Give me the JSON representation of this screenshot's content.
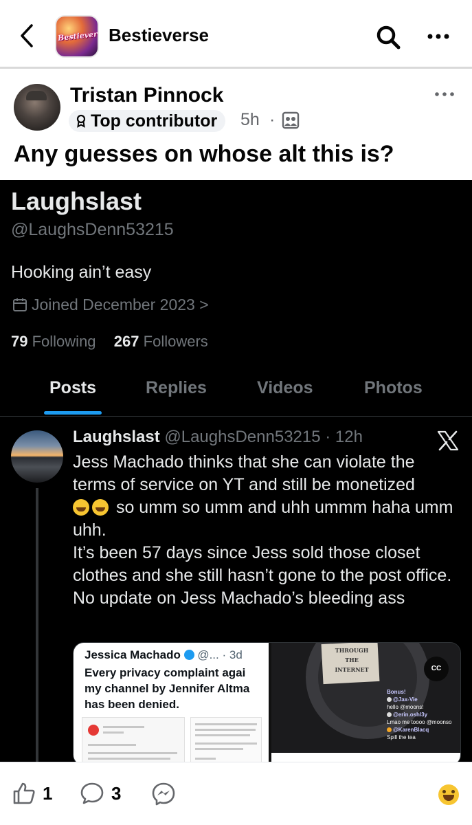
{
  "header": {
    "group_name": "Bestieverse",
    "group_avatar_text": "Bestieverse"
  },
  "post": {
    "author": "Tristan Pinnock",
    "badge": "Top contributor",
    "time": "5h",
    "separator": "·",
    "text": "Any guesses on whose alt this is?"
  },
  "x_profile": {
    "display_name": "Laughslast",
    "handle": "@LaughsDenn53215",
    "bio": "Hooking ain’t easy",
    "joined": "Joined December 2023 >",
    "following_count": "79",
    "following_label": "Following",
    "followers_count": "267",
    "followers_label": "Followers",
    "tabs": [
      "Posts",
      "Replies",
      "Videos",
      "Photos"
    ],
    "active_tab": "Posts"
  },
  "x_tweet": {
    "name": "Laughslast",
    "handle_time": "@LaughsDenn53215 · 12h",
    "line1": "Jess Machado thinks that she can violate the terms of service on YT and still be monetized",
    "line2_after_emoji": "so umm so umm and uhh ummm haha umm uhh.",
    "para2": "It’s been 57 days since Jess sold those closet clothes and she still hasn’t gone to the post office. No update on Jess Machado’s bleeding ass"
  },
  "x_media": {
    "left_author": "Jessica Machado",
    "left_handle": "@... · 3d",
    "left_text_1": "Every privacy complaint agai",
    "left_text_2": "my channel by Jennifer Altma",
    "left_text_3": "has been denied.",
    "right_sign": "THROUGH THE INTERNET",
    "right_cc": "CC",
    "chat": [
      {
        "user": "Bonus!",
        "msg": ""
      },
      {
        "user": "@Jax-Vie",
        "msg": "hello @moons!"
      },
      {
        "user": "@erin.oshl3y",
        "msg": "Lmao me toooo @moonso"
      },
      {
        "user": "@KarenBlacq",
        "msg": "Spill the tea"
      }
    ]
  },
  "actions": {
    "likes": "1",
    "comments": "3"
  },
  "colors": {
    "x_accent": "#1d9bf0",
    "x_background": "#000000",
    "x_secondary_text": "#71767b",
    "fb_text": "#050505",
    "fb_secondary": "#65676b"
  }
}
